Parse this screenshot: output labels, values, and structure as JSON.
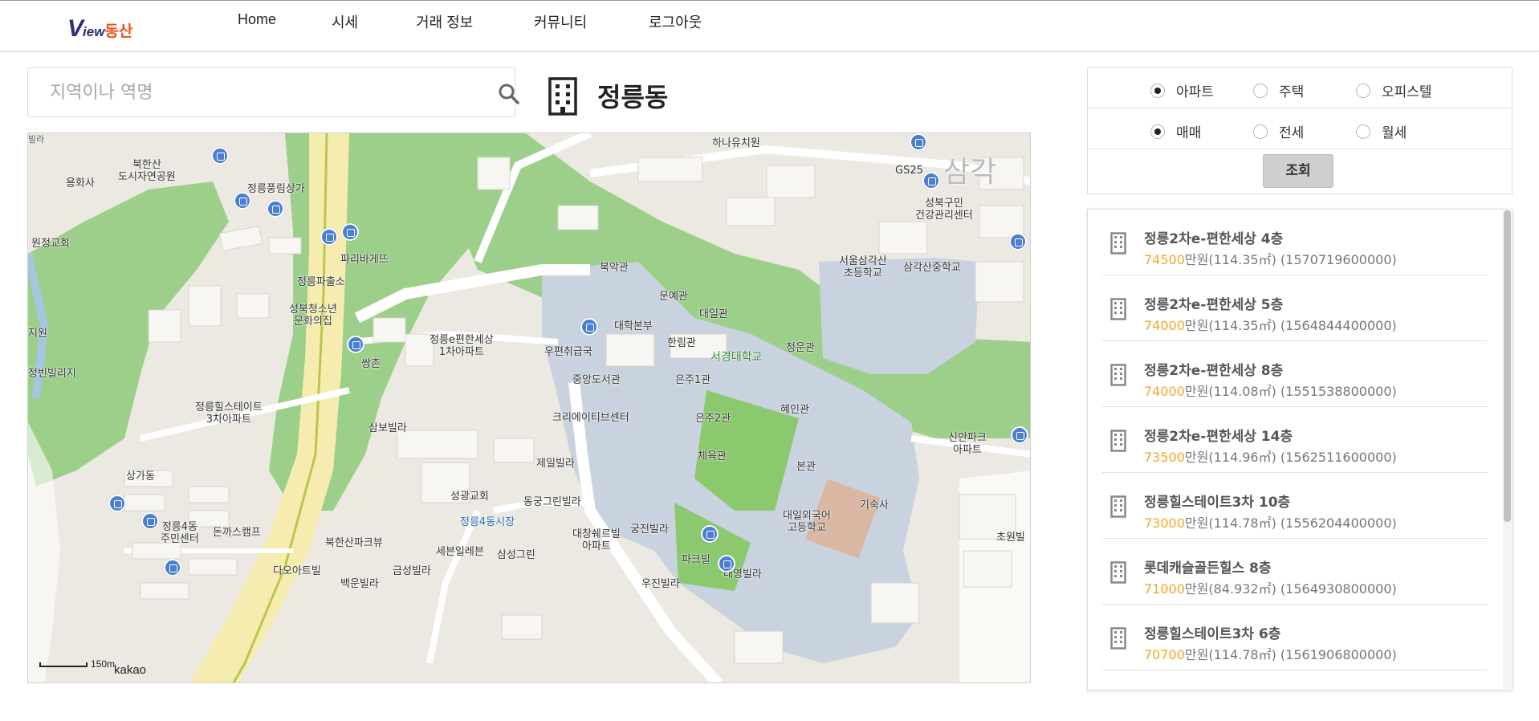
{
  "header": {
    "logo": {
      "v": "V",
      "iew": "iew",
      "ds": "동산"
    },
    "nav": [
      {
        "label": "Home"
      },
      {
        "label": "시세"
      },
      {
        "label": "거래 정보"
      },
      {
        "label": "커뮤니티"
      },
      {
        "label": "로그아웃"
      }
    ]
  },
  "search": {
    "placeholder": "지역이나 역명",
    "value": "",
    "icon": "search-icon"
  },
  "page_title": {
    "text": "정릉동",
    "icon": "building-icon"
  },
  "map": {
    "attribution": "kakao",
    "scale_label": "150m",
    "labels": {
      "l1": "북한산\n도시자연공원",
      "l2": "정릉풍림상가",
      "l3": "용화사",
      "l4": "원정교회",
      "l5": "파리바게뜨",
      "l6": "정릉파출소",
      "l7": "성북청소년\n문화의집",
      "l8": "하나유치원",
      "l9": "GS25",
      "l10": "성북구민\n건강관리센터",
      "l11": "북악관",
      "l12": "문예관",
      "l13": "대일관",
      "l14": "대학본부",
      "l15": "한림관",
      "l16": "청운관",
      "l17": "서경대학교",
      "l18": "정릉e편한세상\n1차아파트",
      "l19": "우편취급국",
      "l20": "중앙도서관",
      "l21": "은주1관",
      "l22": "은주2관",
      "l23": "혜인관",
      "l24": "크리에이티브센터",
      "l25": "체육관",
      "l26": "본관",
      "l27": "서울삼각산\n초등학교",
      "l28": "삼각산중학교",
      "l29": "신안파크\n아파트",
      "l30": "정릉힐스테이트\n3차아파트",
      "l31": "삼보빌라",
      "l32": "제일빌라",
      "l33": "성광교회",
      "l34": "동궁그린빌라",
      "l35": "정릉4동시장",
      "l36": "궁전빌라",
      "l37": "대창쉐르빌\n아파트",
      "l38": "대일외국어\n고등학교",
      "l39": "기숙사",
      "l40": "상가동",
      "l41": "정릉4동\n주민센터",
      "l42": "돈까스캠프",
      "l43": "북한산파크뷰",
      "l44": "다오아트빌",
      "l45": "백운빌라",
      "l46": "금성빌라",
      "l47": "세븐일레븐",
      "l48": "삼성그린",
      "l49": "파크빌",
      "l50": "태영빌라",
      "l51": "우진빌라",
      "l52": "초원빌",
      "l53": "빌라",
      "l54": "지원",
      "l55": "쌍촌",
      "l56": "정빈빌리지",
      "l57": "삼각"
    }
  },
  "filter": {
    "type_options": [
      {
        "label": "아파트",
        "selected": true
      },
      {
        "label": "주택",
        "selected": false
      },
      {
        "label": "오피스텔",
        "selected": false
      }
    ],
    "deal_options": [
      {
        "label": "매매",
        "selected": true
      },
      {
        "label": "전세",
        "selected": false
      },
      {
        "label": "월세",
        "selected": false
      }
    ],
    "submit_label": "조회"
  },
  "listings": [
    {
      "name": "정릉2차e-편한세상 4층",
      "price": "74500",
      "unit": "만원",
      "detail": "(114.35㎡) (1570719600000)"
    },
    {
      "name": "정릉2차e-편한세상 5층",
      "price": "74000",
      "unit": "만원",
      "detail": "(114.35㎡) (1564844400000)"
    },
    {
      "name": "정릉2차e-편한세상 8층",
      "price": "74000",
      "unit": "만원",
      "detail": "(114.08㎡) (1551538800000)"
    },
    {
      "name": "정릉2차e-편한세상 14층",
      "price": "73500",
      "unit": "만원",
      "detail": "(114.96㎡) (1562511600000)"
    },
    {
      "name": "정릉힐스테이트3차 10층",
      "price": "73000",
      "unit": "만원",
      "detail": "(114.78㎡) (1556204400000)"
    },
    {
      "name": "롯데캐슬골든힐스 8층",
      "price": "71000",
      "unit": "만원",
      "detail": "(84.932㎡) (1564930800000)"
    },
    {
      "name": "정릉힐스테이트3차 6층",
      "price": "70700",
      "unit": "만원",
      "detail": "(114.78㎡) (1561906800000)"
    }
  ],
  "colors": {
    "accent_price": "#f5a623",
    "logo_blue": "#2e2e7a",
    "logo_orange": "#e8541a",
    "map_park": "#9ccf8a",
    "map_campus": "#c9d3df",
    "bus_stop": "#4a7fd1"
  }
}
